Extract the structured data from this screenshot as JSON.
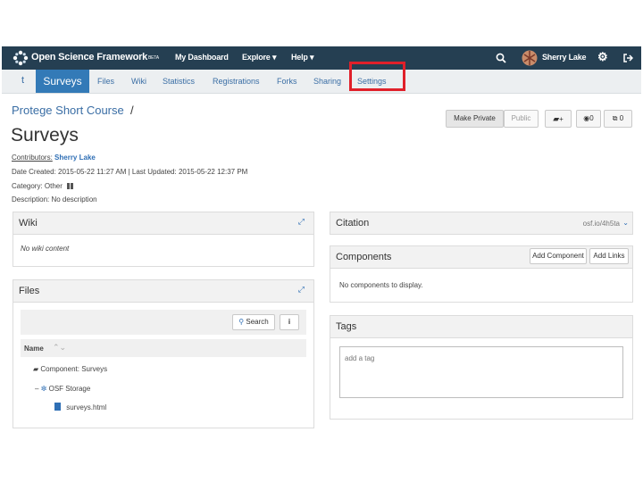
{
  "topnav": {
    "brand": "Open Science Framework",
    "brand_tag": "BETA",
    "dashboard": "My Dashboard",
    "explore": "Explore",
    "help": "Help",
    "user_name": "Sherry Lake",
    "bg_color": "#253f52"
  },
  "subnav": {
    "home_short": "t",
    "active": "Surveys",
    "items": [
      "Files",
      "Wiki",
      "Statistics",
      "Registrations",
      "Forks",
      "Sharing",
      "Settings"
    ],
    "highlight_color": "#e0202a"
  },
  "project": {
    "parent_title": "Protege Short Course",
    "separator": "/",
    "title": "Surveys",
    "contributors_label": "Contributors:",
    "contributor": "Sherry Lake",
    "dates": "Date Created: 2015-05-22 11:27 AM | Last Updated: 2015-05-22 12:37 PM",
    "category": "Category: Other",
    "description": "Description: No description"
  },
  "actions": {
    "make_private": "Make Private",
    "public": "Public",
    "fork_symbol": "+",
    "watch_count": "0",
    "fork_count": "0"
  },
  "wiki": {
    "title": "Wiki",
    "content": "No wiki content"
  },
  "files": {
    "title": "Files",
    "search": "Search",
    "info": "i",
    "column_name": "Name",
    "rows": [
      "Component: Surveys",
      "OSF Storage",
      "surveys.html"
    ]
  },
  "citation": {
    "title": "Citation",
    "short_url": "osf.io/4h5ta"
  },
  "components": {
    "title": "Components",
    "add_component": "Add Component",
    "add_links": "Add Links",
    "empty": "No components to display."
  },
  "tags": {
    "title": "Tags",
    "placeholder": "add a tag"
  }
}
